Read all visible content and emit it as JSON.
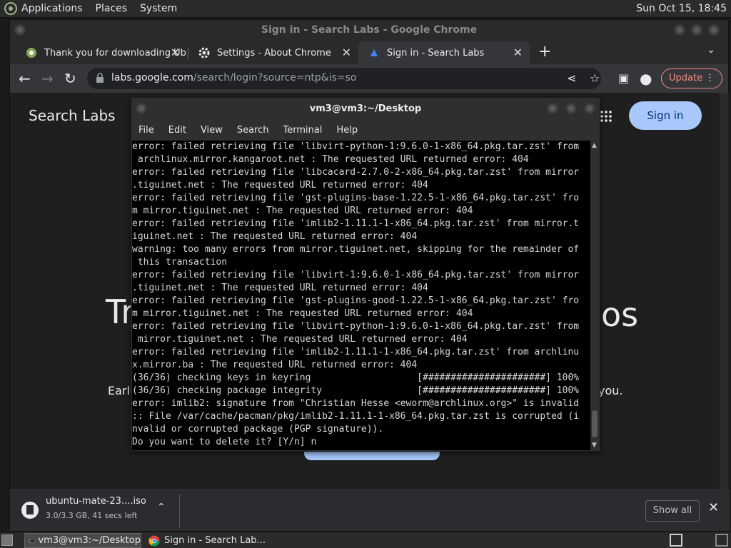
{
  "top_panel": {
    "menus": [
      "Applications",
      "Places",
      "System"
    ],
    "clock": "Sun Oct 15, 18:45"
  },
  "chrome": {
    "title": "Sign in - Search Labs - Google Chrome",
    "tabs": [
      {
        "label": "Thank you for downloading Ubu",
        "icon": "ubuntu-mate-icon"
      },
      {
        "label": "Settings - About Chrome",
        "icon": "gear-icon"
      },
      {
        "label": "Sign in - Search Labs",
        "icon": "search-labs-icon"
      }
    ],
    "url_domain": "labs.google.com",
    "url_path": "/search/login?source=ntp&is=so",
    "update_label": "Update",
    "page": {
      "brand": "Search Labs",
      "signin_label": "Sign in",
      "heading_left": "Tr",
      "heading_right": "os",
      "early_text": "Early",
      "you_text": "you."
    },
    "download": {
      "filename": "ubuntu-mate-23....iso",
      "status": "3.0/3.3 GB, 41 secs left",
      "show_all_label": "Show all"
    }
  },
  "terminal": {
    "title": "vm3@vm3:~/Desktop",
    "menu": [
      "File",
      "Edit",
      "View",
      "Search",
      "Terminal",
      "Help"
    ],
    "output": "error: failed retrieving file 'libvirt-python-1:9.6.0-1-x86_64.pkg.tar.zst' from\n archlinux.mirror.kangaroot.net : The requested URL returned error: 404\nerror: failed retrieving file 'libcacard-2.7.0-2-x86_64.pkg.tar.zst' from mirror\n.tiguinet.net : The requested URL returned error: 404\nerror: failed retrieving file 'gst-plugins-base-1.22.5-1-x86_64.pkg.tar.zst' fro\nm mirror.tiguinet.net : The requested URL returned error: 404\nerror: failed retrieving file 'imlib2-1.11.1-1-x86_64.pkg.tar.zst' from mirror.t\niguinet.net : The requested URL returned error: 404\nwarning: too many errors from mirror.tiguinet.net, skipping for the remainder of\n this transaction\nerror: failed retrieving file 'libvirt-1:9.6.0-1-x86_64.pkg.tar.zst' from mirror\n.tiguinet.net : The requested URL returned error: 404\nerror: failed retrieving file 'gst-plugins-good-1.22.5-1-x86_64.pkg.tar.zst' fro\nm mirror.tiguinet.net : The requested URL returned error: 404\nerror: failed retrieving file 'libvirt-python-1:9.6.0-1-x86_64.pkg.tar.zst' from\n mirror.tiguinet.net : The requested URL returned error: 404\nerror: failed retrieving file 'imlib2-1.11.1-1-x86_64.pkg.tar.zst' from archlinu\nx.mirror.ba : The requested URL returned error: 404\n(36/36) checking keys in keyring                   [######################] 100%\n(36/36) checking package integrity                 [######################] 100%\nerror: imlib2: signature from \"Christian Hesse <eworm@archlinux.org>\" is invalid\n:: File /var/cache/pacman/pkg/imlib2-1.11.1-1-x86_64.pkg.tar.zst is corrupted (i\nnvalid or corrupted package (PGP signature)).\nDo you want to delete it? [Y/n] n"
  },
  "taskbar": {
    "items": [
      {
        "label": "vm3@vm3:~/Desktop",
        "icon": "terminal-icon"
      },
      {
        "label": "Sign in - Search Lab...",
        "icon": "chrome-icon"
      }
    ]
  }
}
